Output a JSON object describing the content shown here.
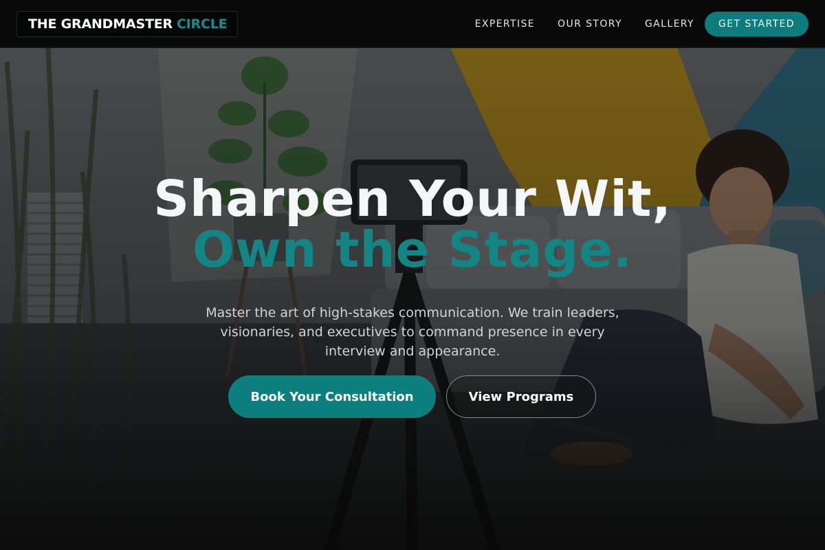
{
  "brand": {
    "name_primary": "THE GRANDMASTER",
    "name_accent": "CIRCLE",
    "accent_color": "#0e7f7f"
  },
  "nav": {
    "links": [
      {
        "label": "EXPERTISE"
      },
      {
        "label": "OUR STORY"
      },
      {
        "label": "GALLERY"
      }
    ],
    "cta_label": "GET STARTED"
  },
  "hero": {
    "headline_line1": "Sharpen Your Wit,",
    "headline_line2": "Own the Stage.",
    "subtitle": "Master the art of high-stakes communication. We train leaders, visionaries, and executives to command presence in every interview and appearance.",
    "primary_button": "Book Your Consultation",
    "secondary_button": "View Programs"
  }
}
